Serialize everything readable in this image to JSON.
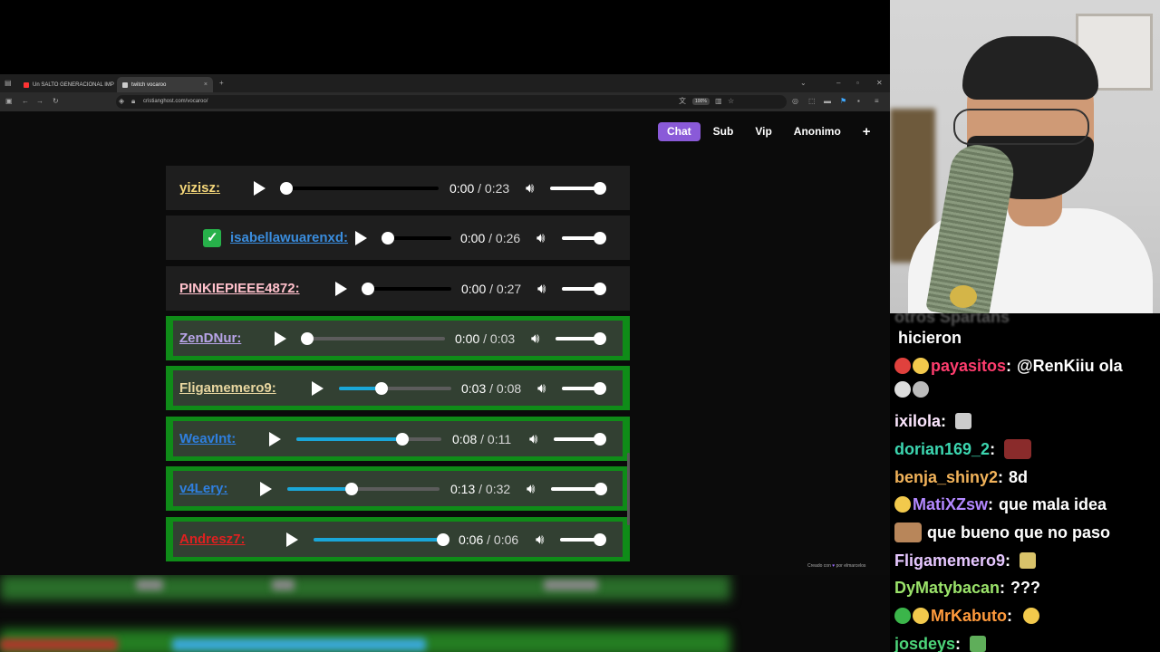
{
  "browser": {
    "tabs": [
      {
        "title": "Un SALTO GENERACIONAL IMP",
        "close": "×"
      },
      {
        "title": "twitch vocaroo",
        "close": "×"
      }
    ],
    "new_tab": "+",
    "url": "cristianghost.com/vocaroo/",
    "zoom": "100%",
    "window_controls": [
      "⌄",
      "–",
      "▫",
      "✕"
    ]
  },
  "filters": {
    "buttons": [
      "Chat",
      "Sub",
      "Vip",
      "Anonimo"
    ],
    "active": "Chat",
    "plus": "+"
  },
  "messages": [
    {
      "user": "yizisz:",
      "color": "#f5d77a",
      "current": "0:00",
      "duration": "0:23",
      "progress": 0.0,
      "highlight": false,
      "badge": false
    },
    {
      "user": "isabellawuarenxd:",
      "color": "#3a8dde",
      "current": "0:00",
      "duration": "0:26",
      "progress": 0.0,
      "highlight": false,
      "badge": true
    },
    {
      "user": "PINKIEPIEEE4872:",
      "color": "#ffc0cb",
      "current": "0:00",
      "duration": "0:27",
      "progress": 0.0,
      "highlight": false,
      "badge": false
    },
    {
      "user": "ZenDNur:",
      "color": "#b8a4e8",
      "current": "0:00",
      "duration": "0:03",
      "progress": 0.0,
      "highlight": true,
      "badge": false
    },
    {
      "user": "Fligamemero9:",
      "color": "#e8d6a0",
      "current": "0:03",
      "duration": "0:08",
      "progress": 0.38,
      "highlight": true,
      "badge": false
    },
    {
      "user": "WeavInt:",
      "color": "#2f7fe0",
      "current": "0:08",
      "duration": "0:11",
      "progress": 0.73,
      "highlight": true,
      "badge": false
    },
    {
      "user": "v4Lery:",
      "color": "#2f7fe0",
      "current": "0:13",
      "duration": "0:32",
      "progress": 0.42,
      "highlight": true,
      "badge": false
    },
    {
      "user": "Andresz7:",
      "color": "#e02020",
      "current": "0:06",
      "duration": "0:06",
      "progress": 1.0,
      "highlight": true,
      "badge": false
    }
  ],
  "time_separator": " / ",
  "credit": {
    "prefix": "Creado con",
    "heart": "♥",
    "suffix": "por elmarcelos"
  },
  "chat": {
    "faded_line": "otros Spartans",
    "lines": [
      {
        "user": "",
        "color": "#ffffff",
        "text": "hicieron",
        "emotes": []
      },
      {
        "user": "payasitos",
        "color": "#ff3d6e",
        "text": "@RenKiiu ola",
        "emotes": [
          "#e0413d",
          "#f2c94c"
        ]
      },
      {
        "user": "",
        "color": "#ffffff",
        "text": "",
        "emotes": [
          "#dddddd",
          "#bbbbbb"
        ]
      },
      {
        "user": "ixilola",
        "color": "#fde7ff",
        "text": "",
        "emotes": [
          "#cccccc"
        ]
      },
      {
        "user": "dorian169_2",
        "color": "#3cd6b0",
        "text": "",
        "emotes": [
          "#8a2b2b"
        ]
      },
      {
        "user": "benja_shiny2",
        "color": "#f2b35a",
        "text": "8d",
        "emotes": []
      },
      {
        "user": "MatiXZsw",
        "color": "#b388ff",
        "text": "que mala idea",
        "emotes": [
          "#f2c94c"
        ]
      },
      {
        "user": "",
        "color": "#ffffff",
        "text": "que bueno que no paso",
        "emotes": [
          "#b8865a"
        ]
      },
      {
        "user": "Fligamemero9",
        "color": "#e6c7ff",
        "text": "",
        "emotes": [
          "#d9c36a"
        ]
      },
      {
        "user": "DyMatybacan",
        "color": "#9be36a",
        "text": "???",
        "emotes": []
      },
      {
        "user": "MrKabuto",
        "color": "#ff9a3c",
        "text": "",
        "emotes": [
          "#3bb54a",
          "#f2c94c",
          "#f2c94c"
        ]
      },
      {
        "user": "josdeys",
        "color": "#4dd67a",
        "text": "",
        "emotes": [
          "#5fae5a"
        ]
      }
    ]
  }
}
